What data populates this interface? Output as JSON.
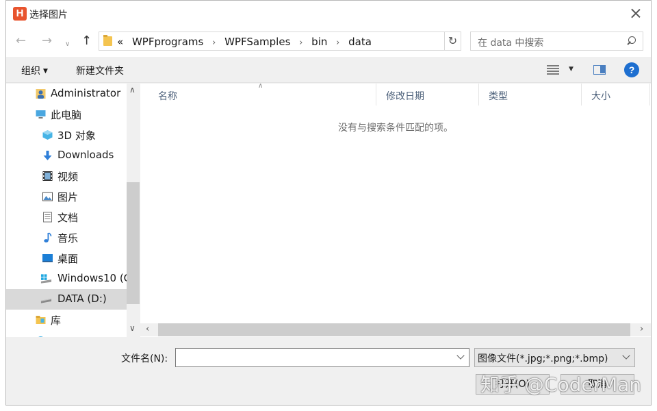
{
  "window": {
    "title": "选择图片",
    "app_icon_letter": "H"
  },
  "nav": {
    "back_icon": "arrow-left-icon",
    "forward_icon": "arrow-right-icon",
    "up_icon": "arrow-up-icon",
    "breadcrumb_prefix": "«",
    "breadcrumb": [
      "WPFprograms",
      "WPFSamples",
      "bin",
      "data"
    ],
    "search_placeholder": "在 data 中搜索"
  },
  "toolbar": {
    "organize": "组织",
    "new_folder": "新建文件夹",
    "help": "?"
  },
  "tree": [
    {
      "label": "Administrator",
      "icon": "user-icon"
    },
    {
      "label": "此电脑",
      "icon": "computer-icon"
    },
    {
      "label": "3D 对象",
      "icon": "cube-icon"
    },
    {
      "label": "Downloads",
      "icon": "download-icon"
    },
    {
      "label": "视频",
      "icon": "video-icon"
    },
    {
      "label": "图片",
      "icon": "picture-icon"
    },
    {
      "label": "文档",
      "icon": "document-icon"
    },
    {
      "label": "音乐",
      "icon": "music-icon"
    },
    {
      "label": "桌面",
      "icon": "desktop-icon"
    },
    {
      "label": "Windows10 (C",
      "icon": "os-drive-icon"
    },
    {
      "label": "DATA (D:)",
      "icon": "drive-icon",
      "selected": true
    },
    {
      "label": "库",
      "icon": "library-icon"
    },
    {
      "label": "",
      "icon": "network-icon"
    }
  ],
  "columns": [
    "名称",
    "修改日期",
    "类型",
    "大小"
  ],
  "empty_message": "没有与搜索条件匹配的项。",
  "bottom": {
    "filename_label": "文件名(N):",
    "filename_value": "",
    "filetype": "图像文件(*.jpg;*.png;*.bmp)",
    "open_button": "打开(O)",
    "cancel_button": "取消"
  },
  "watermark": "知乎 @CoderMan"
}
